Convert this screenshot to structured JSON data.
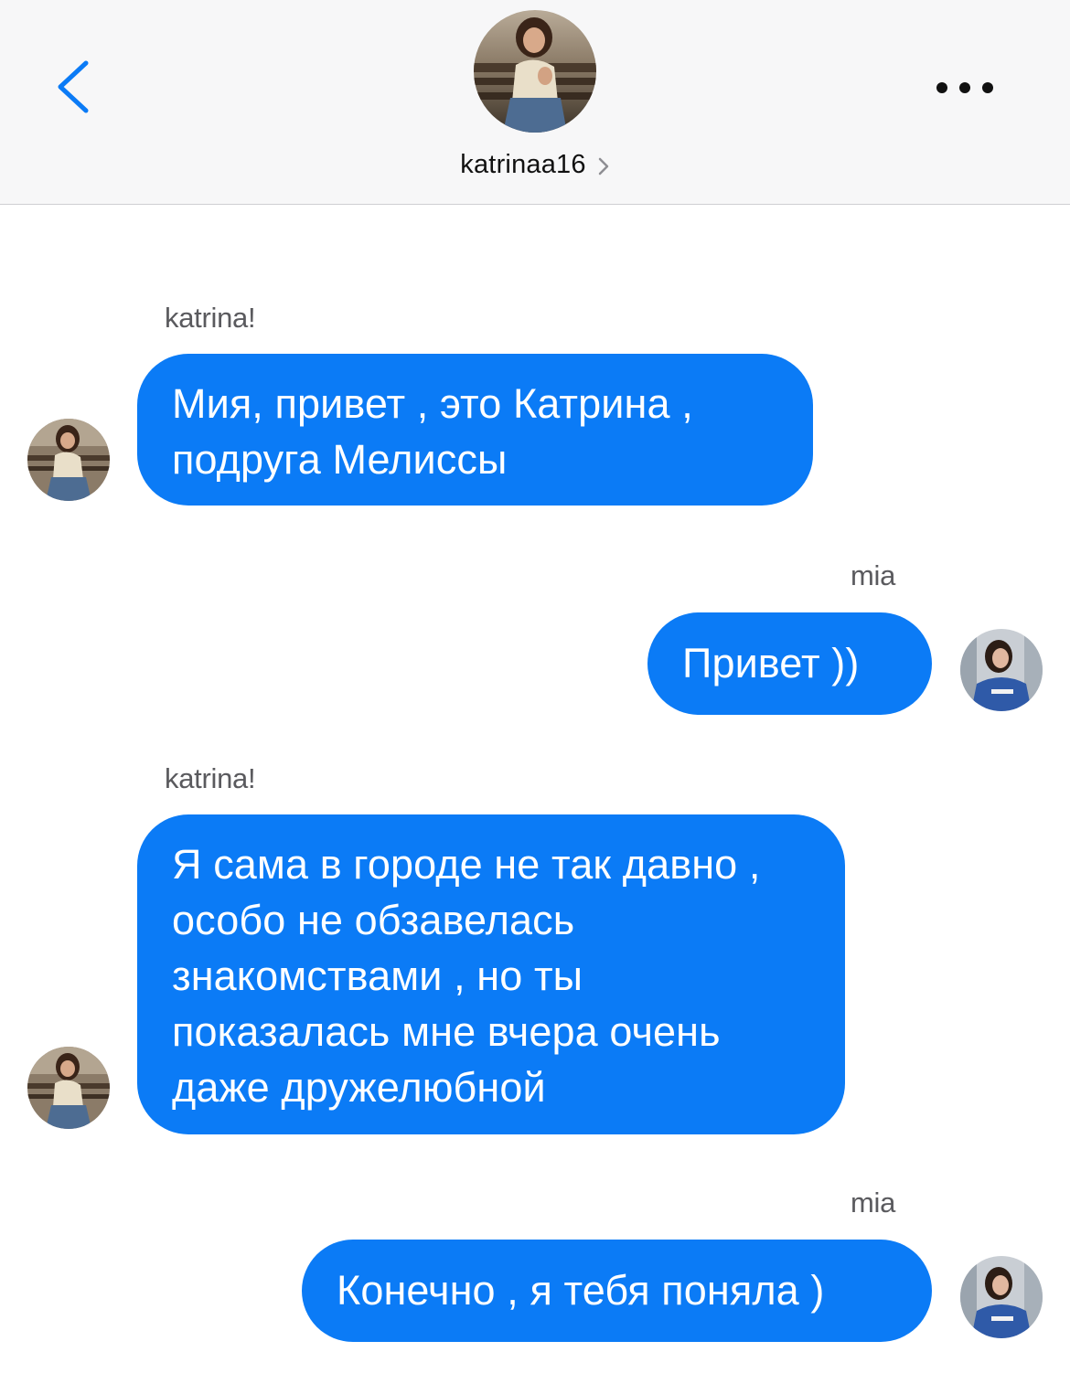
{
  "header": {
    "username": "katrinaa16",
    "back_icon": "chevron-left-icon",
    "more_icon": "more-dots-icon",
    "accent_color": "#0b7bf6"
  },
  "messages": [
    {
      "sender_label": "katrina!",
      "text": "Мия, привет , это Катрина , подруга Мелиссы",
      "direction": "incoming"
    },
    {
      "sender_label": "mia",
      "text": "Привет ))",
      "direction": "outgoing"
    },
    {
      "sender_label": "katrina!",
      "text": "Я сама в городе не так давно , особо не обзавелась знакомствами , но ты показалась мне вчера очень даже дружелюбной",
      "direction": "incoming"
    },
    {
      "sender_label": "mia",
      "text": "Конечно , я тебя поняла )",
      "direction": "outgoing"
    }
  ],
  "bubble_color": "#0b7bf6"
}
